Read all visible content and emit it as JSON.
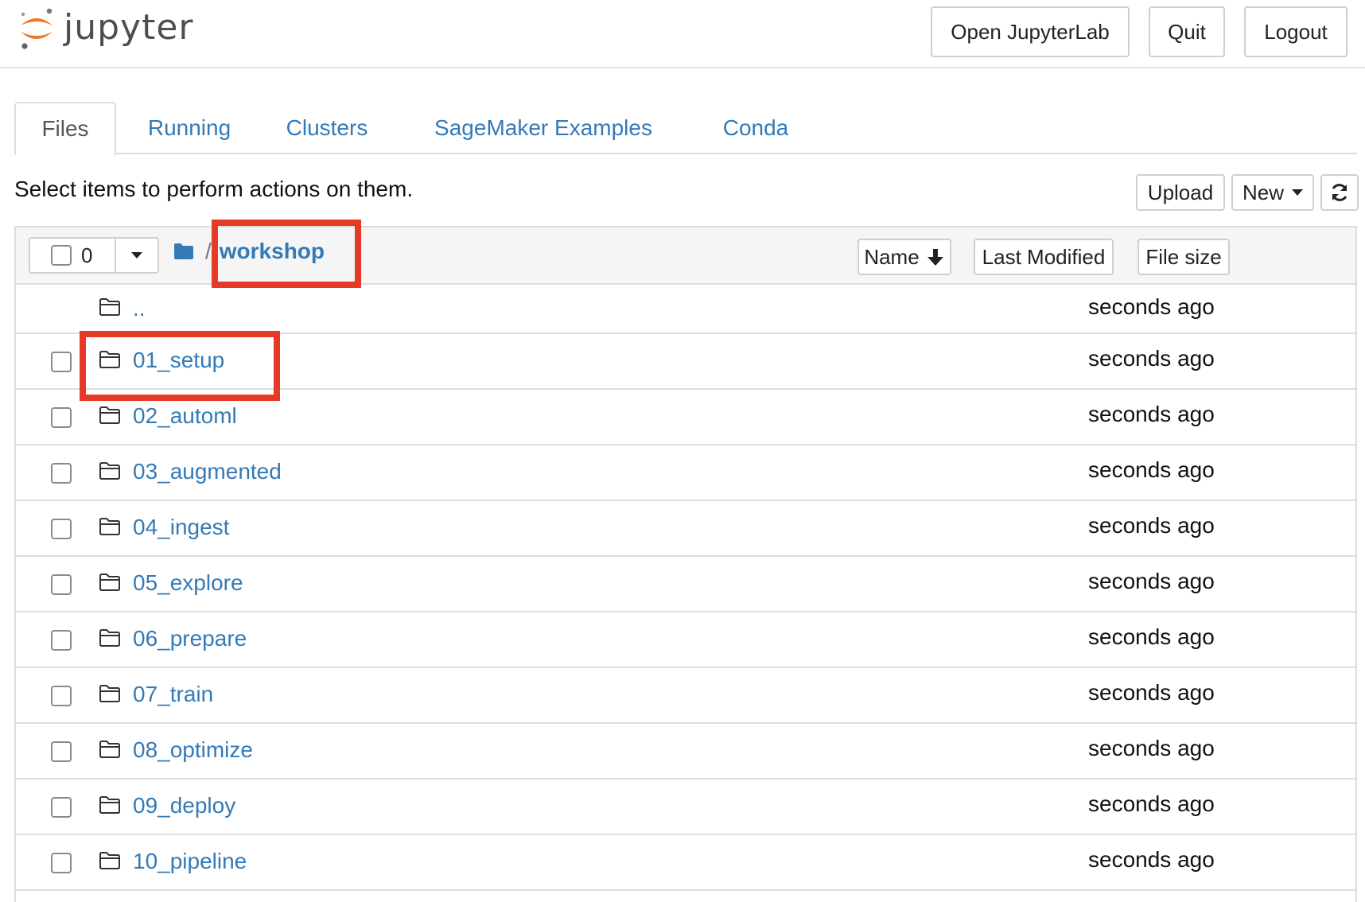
{
  "header": {
    "logo_text": "jupyter",
    "buttons": {
      "open_jupyterlab": "Open JupyterLab",
      "quit": "Quit",
      "logout": "Logout"
    }
  },
  "tabs": [
    {
      "label": "Files",
      "active": true
    },
    {
      "label": "Running",
      "active": false
    },
    {
      "label": "Clusters",
      "active": false
    },
    {
      "label": "SageMaker Examples",
      "active": false
    },
    {
      "label": "Conda",
      "active": false
    }
  ],
  "toolbar": {
    "hint": "Select items to perform actions on them.",
    "upload": "Upload",
    "new": "New",
    "refresh_icon": "refresh-icon"
  },
  "list_header": {
    "selected_count": "0",
    "separator": "/",
    "current_folder": "workshop",
    "sort_name": "Name",
    "sort_last_modified": "Last Modified",
    "sort_file_size": "File size"
  },
  "rows": [
    {
      "name": "..",
      "modified": "seconds ago",
      "checkbox": false
    },
    {
      "name": "01_setup",
      "modified": "seconds ago",
      "checkbox": true
    },
    {
      "name": "02_automl",
      "modified": "seconds ago",
      "checkbox": true
    },
    {
      "name": "03_augmented",
      "modified": "seconds ago",
      "checkbox": true
    },
    {
      "name": "04_ingest",
      "modified": "seconds ago",
      "checkbox": true
    },
    {
      "name": "05_explore",
      "modified": "seconds ago",
      "checkbox": true
    },
    {
      "name": "06_prepare",
      "modified": "seconds ago",
      "checkbox": true
    },
    {
      "name": "07_train",
      "modified": "seconds ago",
      "checkbox": true
    },
    {
      "name": "08_optimize",
      "modified": "seconds ago",
      "checkbox": true
    },
    {
      "name": "09_deploy",
      "modified": "seconds ago",
      "checkbox": true
    },
    {
      "name": "10_pipeline",
      "modified": "seconds ago",
      "checkbox": true
    }
  ],
  "colors": {
    "link": "#337ab7",
    "highlight": "#e53a27",
    "jupyter_orange": "#f37726"
  }
}
